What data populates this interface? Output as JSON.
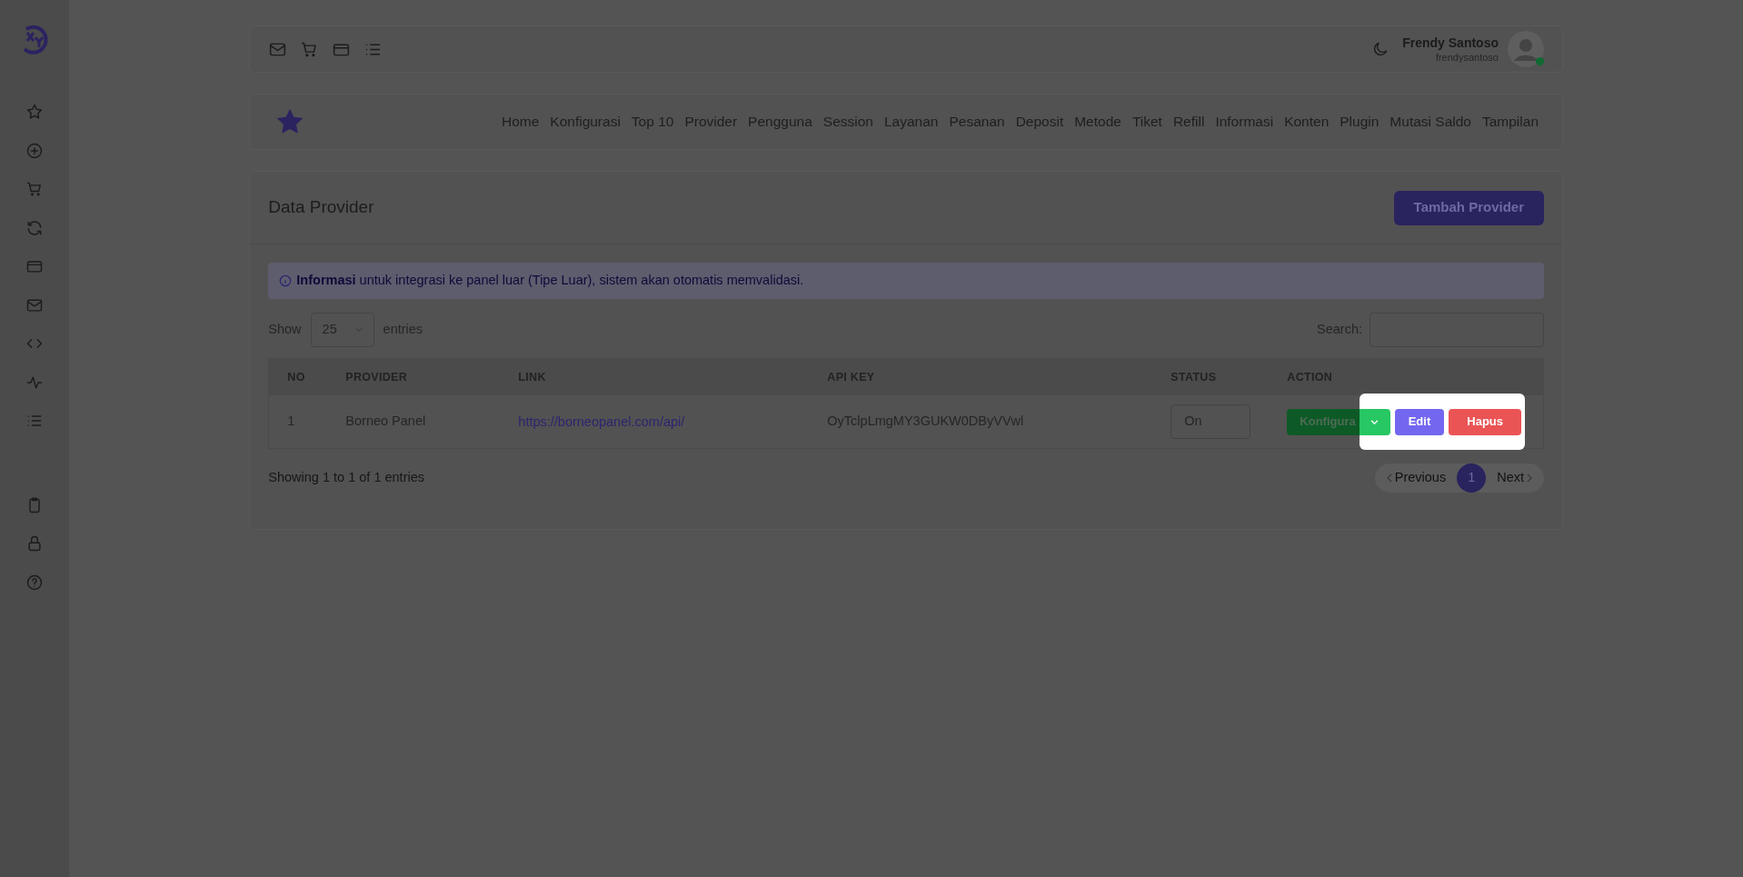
{
  "topbar": {
    "user": {
      "name": "Frendy Santoso",
      "username": "frendysantoso",
      "online": true
    }
  },
  "nav": {
    "items": [
      "Home",
      "Konfigurasi",
      "Top 10",
      "Provider",
      "Pengguna",
      "Session",
      "Layanan",
      "Pesanan",
      "Deposit",
      "Metode",
      "Tiket",
      "Refill",
      "Informasi",
      "Konten",
      "Plugin",
      "Mutasi Saldo",
      "Tampilan"
    ]
  },
  "card": {
    "title": "Data Provider",
    "add_button": "Tambah Provider",
    "alert": "**Informasi** untuk integrasi ke panel luar (Tipe Luar), sistem akan otomatis memvalidasi.",
    "length": {
      "show": "Show",
      "value": "25",
      "entries": "entries"
    },
    "search": {
      "label": "Search:"
    },
    "table": {
      "columns": [
        "NO",
        "PROVIDER",
        "LINK",
        "API KEY",
        "STATUS",
        "ACTION"
      ],
      "rows": [
        {
          "no": "1",
          "provider": "Borneo Panel",
          "link": "https://borneopanel.com/api/",
          "api_key": "OyTclpLmgMY3GUKW0DByVVwl",
          "status": "On",
          "actions": [
            {
              "kind": "split",
              "label": "Konfigura",
              "highlighted": false
            },
            {
              "kind": "caret",
              "highlighted": true
            },
            {
              "kind": "edit",
              "label": "Edit",
              "highlighted": true
            },
            {
              "kind": "delete",
              "label": "Hapus",
              "highlighted": true
            }
          ]
        }
      ]
    },
    "info": "Showing 1 to 1 of 1 entries",
    "pagination": [
      {
        "label": "Previous",
        "kind": "prev",
        "selected": false
      },
      {
        "label": "1",
        "kind": "page",
        "selected": true
      },
      {
        "label": "Next",
        "kind": "next",
        "selected": false
      }
    ]
  }
}
